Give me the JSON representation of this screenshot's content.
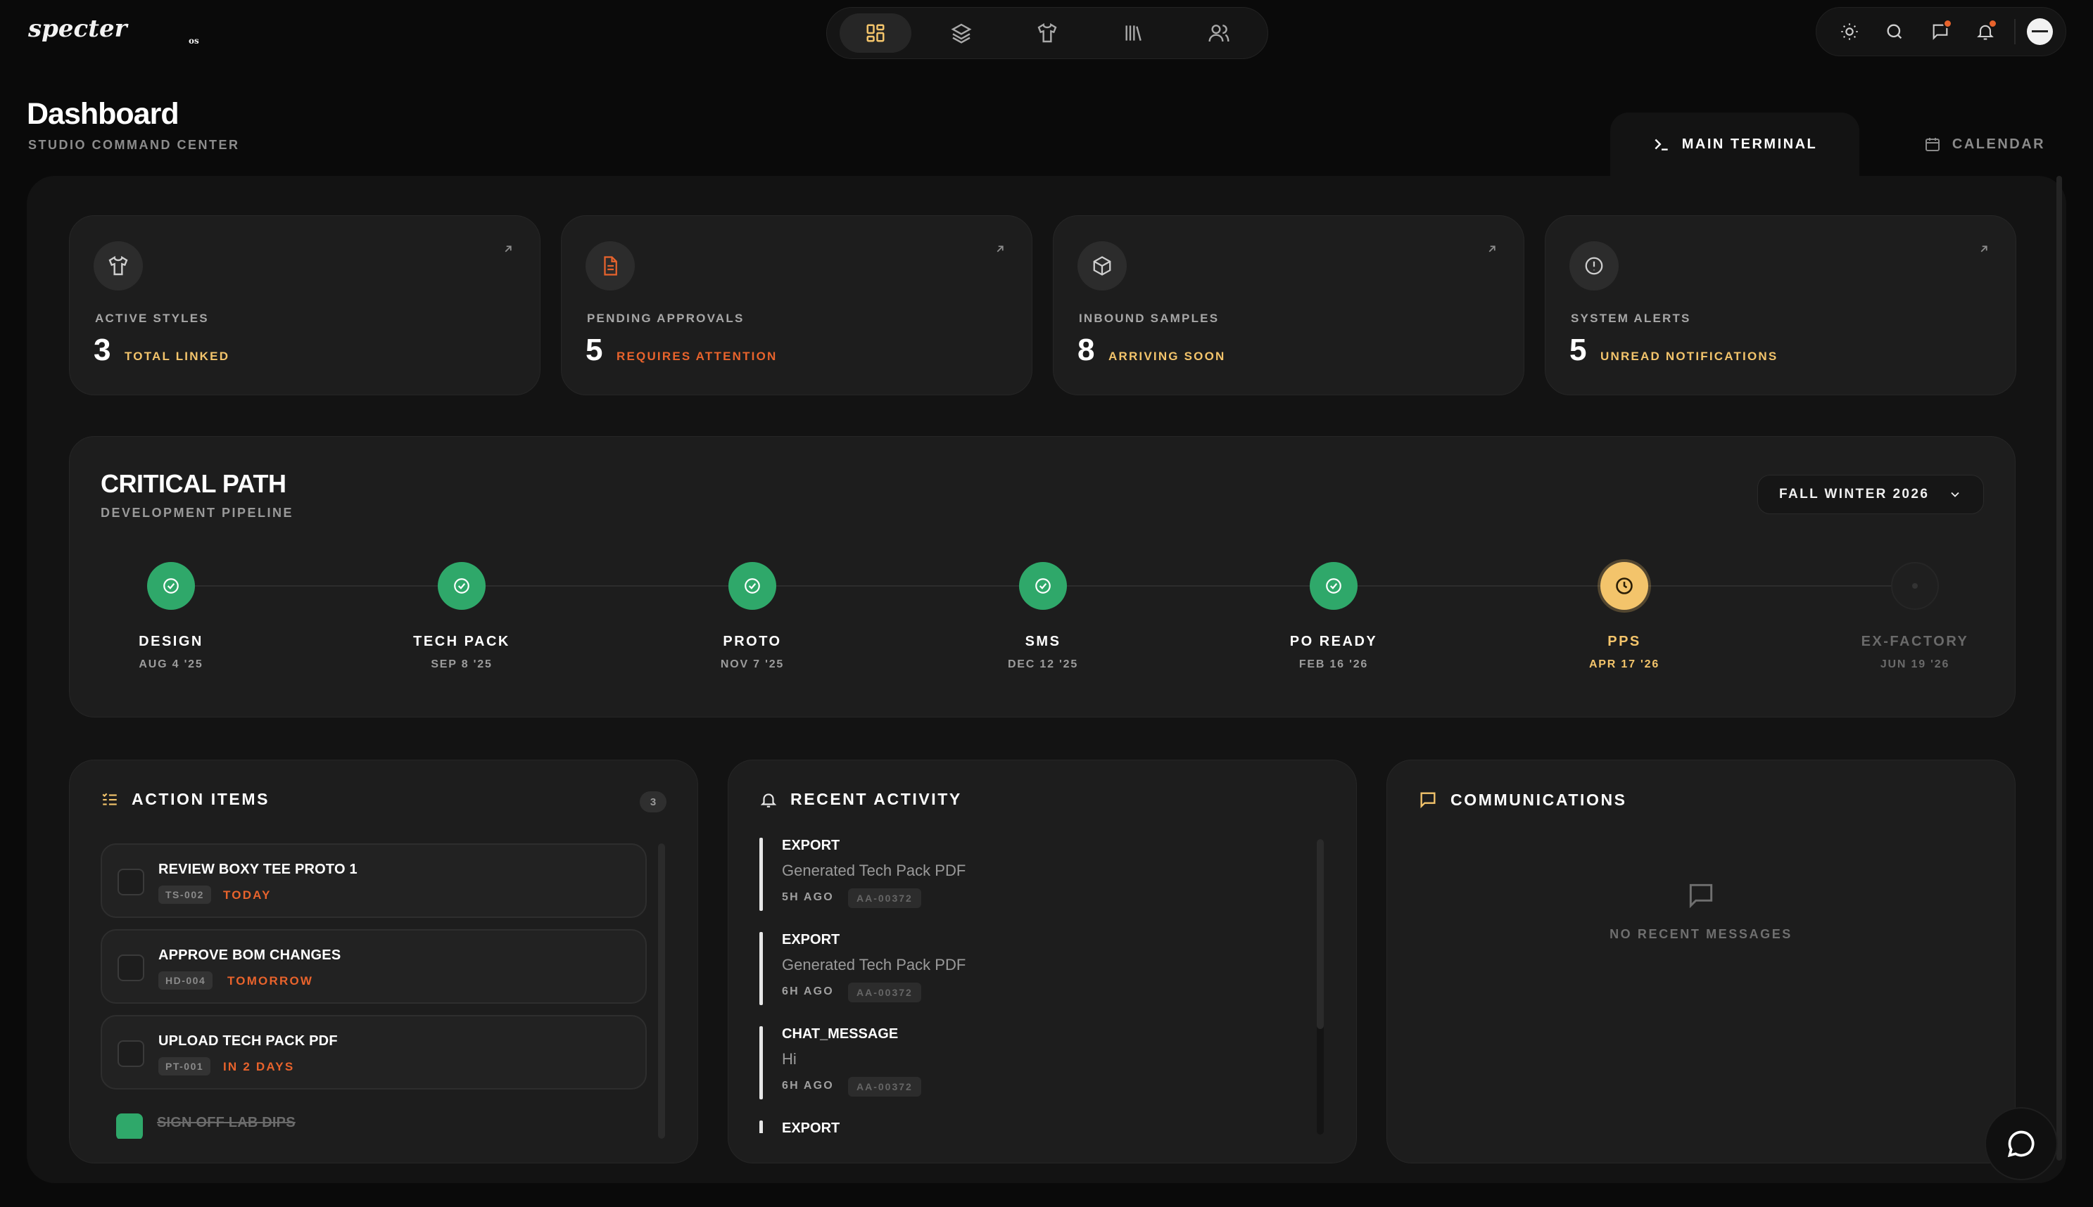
{
  "brand": {
    "logo_text": "specter",
    "logo_sub": "os"
  },
  "topnav": {
    "items": [
      {
        "icon": "dashboard-grid-icon",
        "active": true
      },
      {
        "icon": "layers-icon",
        "active": false
      },
      {
        "icon": "tshirt-icon",
        "active": false
      },
      {
        "icon": "library-icon",
        "active": false
      },
      {
        "icon": "users-icon",
        "active": false
      }
    ]
  },
  "toolbar": {
    "items": [
      "sun-icon",
      "search-icon",
      "chat-bubble-icon",
      "bell-icon"
    ],
    "notification_dot_color": "#e8632c"
  },
  "header": {
    "title": "Dashboard",
    "subtitle": "STUDIO COMMAND CENTER"
  },
  "tabs": [
    {
      "label": "MAIN TERMINAL",
      "icon": "terminal-icon",
      "active": true
    },
    {
      "label": "CALENDAR",
      "icon": "calendar-icon",
      "active": false
    }
  ],
  "stats": [
    {
      "label": "ACTIVE STYLES",
      "value": "3",
      "note": "TOTAL LINKED",
      "note_color": "#f3c46b",
      "icon": "tshirt-icon"
    },
    {
      "label": "PENDING APPROVALS",
      "value": "5",
      "note": "REQUIRES ATTENTION",
      "note_color": "#e8632c",
      "icon": "document-icon"
    },
    {
      "label": "INBOUND SAMPLES",
      "value": "8",
      "note": "ARRIVING SOON",
      "note_color": "#f3c46b",
      "icon": "package-icon"
    },
    {
      "label": "SYSTEM ALERTS",
      "value": "5",
      "note": "UNREAD NOTIFICATIONS",
      "note_color": "#f3c46b",
      "icon": "alert-circle-icon"
    }
  ],
  "critical_path": {
    "title": "CRITICAL PATH",
    "subtitle": "DEVELOPMENT PIPELINE",
    "season": "FALL WINTER 2026",
    "stages": [
      {
        "name": "DESIGN",
        "date": "AUG 4 '25",
        "status": "done"
      },
      {
        "name": "TECH PACK",
        "date": "SEP 8 '25",
        "status": "done"
      },
      {
        "name": "PROTO",
        "date": "NOV 7 '25",
        "status": "done"
      },
      {
        "name": "SMS",
        "date": "DEC 12 '25",
        "status": "done"
      },
      {
        "name": "PO READY",
        "date": "FEB 16 '26",
        "status": "done"
      },
      {
        "name": "PPS",
        "date": "APR 17 '26",
        "status": "current"
      },
      {
        "name": "EX-FACTORY",
        "date": "JUN 19 '26",
        "status": "future"
      }
    ]
  },
  "action_items": {
    "title": "ACTION ITEMS",
    "count": "3",
    "items": [
      {
        "title": "REVIEW BOXY TEE PROTO 1",
        "code": "TS-002",
        "due": "TODAY",
        "done": false
      },
      {
        "title": "APPROVE BOM CHANGES",
        "code": "HD-004",
        "due": "TOMORROW",
        "done": false
      },
      {
        "title": "UPLOAD TECH PACK PDF",
        "code": "PT-001",
        "due": "IN 2 DAYS",
        "done": false
      },
      {
        "title": "SIGN OFF LAB DIPS",
        "code": "",
        "due": "",
        "done": true
      }
    ]
  },
  "recent_activity": {
    "title": "RECENT ACTIVITY",
    "items": [
      {
        "type": "EXPORT",
        "desc": "Generated Tech Pack PDF",
        "time": "5H AGO",
        "ref": "AA-00372"
      },
      {
        "type": "EXPORT",
        "desc": "Generated Tech Pack PDF",
        "time": "6H AGO",
        "ref": "AA-00372"
      },
      {
        "type": "CHAT_MESSAGE",
        "desc": "Hi",
        "time": "6H AGO",
        "ref": "AA-00372"
      },
      {
        "type": "EXPORT",
        "desc": "",
        "time": "",
        "ref": ""
      }
    ]
  },
  "communications": {
    "title": "COMMUNICATIONS",
    "empty_text": "NO RECENT MESSAGES"
  },
  "colors": {
    "accent_gold": "#f3c46b",
    "accent_orange": "#e8632c",
    "success_green": "#2fa86a"
  }
}
